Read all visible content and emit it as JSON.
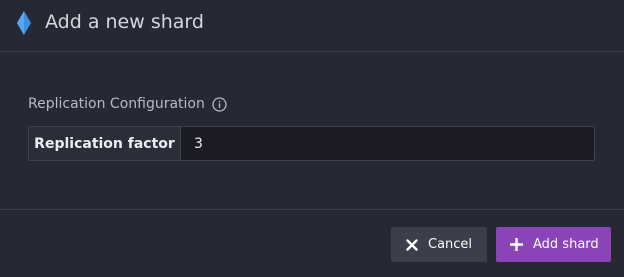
{
  "dialog": {
    "title": "Add a new shard",
    "logo_icon": "diamond-logo-icon"
  },
  "replication": {
    "section_label": "Replication Configuration",
    "info_icon": "info-icon",
    "factor_label": "Replication factor",
    "factor_value": "3"
  },
  "footer": {
    "cancel_label": "Cancel",
    "cancel_icon": "close-icon",
    "add_label": "Add shard",
    "add_icon": "plus-icon"
  },
  "colors": {
    "background": "#262834",
    "accent": "#8a44b8",
    "secondary_button": "#3c3e4b",
    "logo_blue": "#3d8fe0"
  }
}
